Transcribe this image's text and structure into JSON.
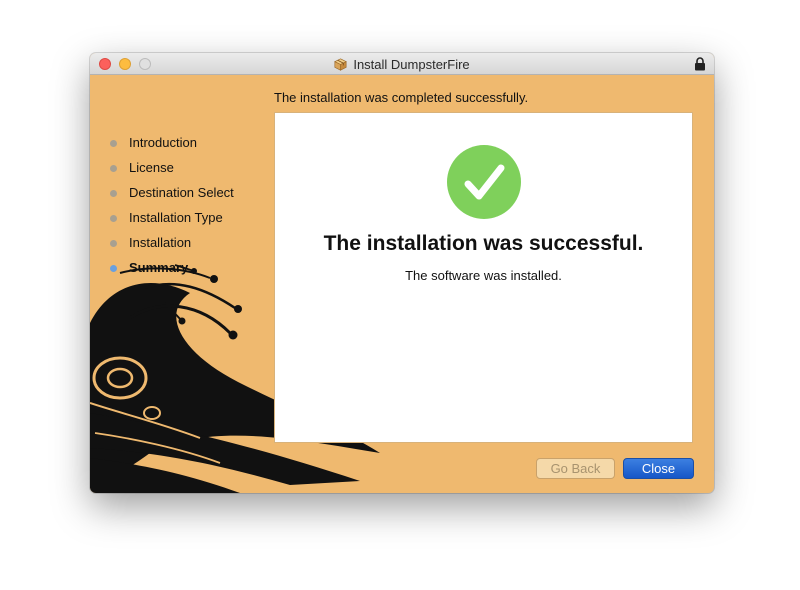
{
  "window": {
    "title": "Install DumpsterFire",
    "title_icon": "package-icon",
    "lock_icon": "lock-icon"
  },
  "heading": "The installation was completed successfully.",
  "steps": [
    {
      "label": "Introduction",
      "active": false
    },
    {
      "label": "License",
      "active": false
    },
    {
      "label": "Destination Select",
      "active": false
    },
    {
      "label": "Installation Type",
      "active": false
    },
    {
      "label": "Installation",
      "active": false
    },
    {
      "label": "Summary",
      "active": true
    }
  ],
  "content": {
    "icon": "checkmark-icon",
    "title": "The installation was successful.",
    "subtitle": "The software was installed."
  },
  "buttons": {
    "back": {
      "label": "Go Back",
      "enabled": false
    },
    "close": {
      "label": "Close",
      "enabled": true
    }
  },
  "colors": {
    "background": "#efb96f",
    "accent": "#1f66d6",
    "success": "#7fd05b",
    "active_step": "#6aa0de",
    "inactive_step": "#a8a090"
  }
}
